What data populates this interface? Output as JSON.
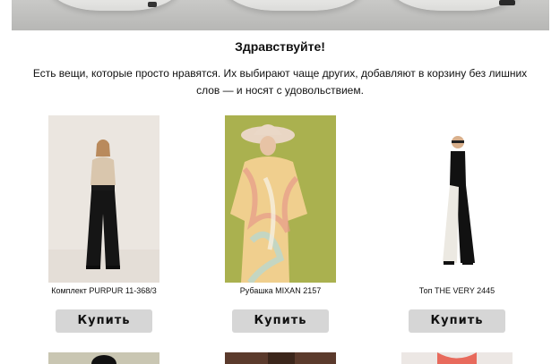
{
  "greeting": "Здравствуйте!",
  "intro": "Есть вещи, которые просто нравятся. Их выбирают чаще других, добавляют в корзину без лишних слов — и носят с удовольствием.",
  "products": [
    {
      "name": "Комплект PURPUR 11-368/3",
      "buy_label": "Купить"
    },
    {
      "name": "Рубашка MIXAN 2157",
      "buy_label": "Купить"
    },
    {
      "name": "Топ THE VERY 2445",
      "buy_label": "Купить"
    }
  ],
  "colors": {
    "button_bg": "#d6d6d6",
    "photo1_bg": "#ebe6e0",
    "photo2_bg": "#aab14f",
    "photo3_bg": "#ffffff"
  }
}
